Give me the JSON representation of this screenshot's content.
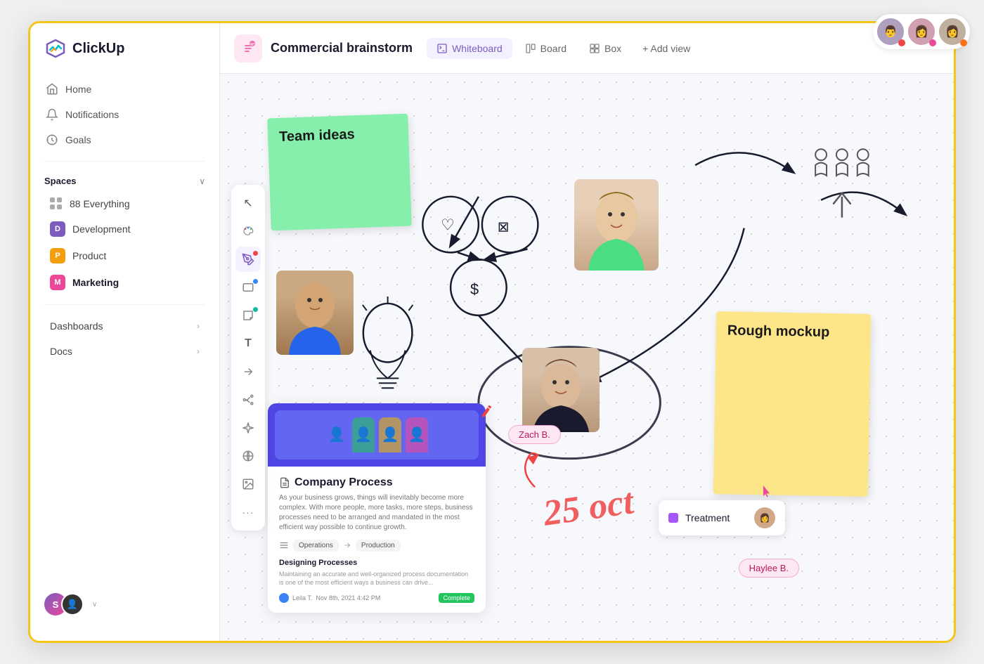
{
  "app": {
    "name": "ClickUp"
  },
  "sidebar": {
    "nav": [
      {
        "id": "home",
        "label": "Home",
        "icon": "🏠"
      },
      {
        "id": "notifications",
        "label": "Notifications",
        "icon": "🔔"
      },
      {
        "id": "goals",
        "label": "Goals",
        "icon": "🏆"
      }
    ],
    "spaces_label": "Spaces",
    "spaces": [
      {
        "id": "everything",
        "label": "Everything",
        "count": "88",
        "type": "everything"
      },
      {
        "id": "development",
        "label": "Development",
        "initial": "D",
        "color": "#7c5cbf"
      },
      {
        "id": "product",
        "label": "Product",
        "initial": "P",
        "color": "#f59e0b"
      },
      {
        "id": "marketing",
        "label": "Marketing",
        "initial": "M",
        "color": "#ec4899",
        "bold": true
      }
    ],
    "sections": [
      {
        "id": "dashboards",
        "label": "Dashboards"
      },
      {
        "id": "docs",
        "label": "Docs"
      }
    ]
  },
  "header": {
    "page_icon": "📦",
    "page_title": "Commercial brainstorm",
    "tabs": [
      {
        "id": "whiteboard",
        "label": "Whiteboard",
        "icon": "✏️",
        "active": true
      },
      {
        "id": "board",
        "label": "Board",
        "icon": "⬜"
      },
      {
        "id": "box",
        "label": "Box",
        "icon": "⊞"
      }
    ],
    "add_view_label": "+ Add view"
  },
  "whiteboard": {
    "sticky_green": "Team ideas",
    "sticky_yellow": "Rough mockup",
    "doc_title": "Company Process",
    "doc_desc": "As your business grows, things will inevitably become more complex. With more people, more tasks, more steps, business processes need to be arranged and mandated in the most efficient way possible to continue growth.",
    "doc_flow_from": "Operations",
    "doc_flow_to": "Production",
    "doc_section": "Designing Processes",
    "doc_section_text": "Maintaining an accurate and well-organized process documentation is one of the most efficient ways a business can drive...",
    "doc_author": "Leila T.",
    "doc_date": "Nov 8th, 2021 4:42 PM",
    "doc_status": "Complete",
    "treatment_label": "Treatment",
    "label_zach": "Zach B.",
    "label_haylee": "Haylee B.",
    "date_annotation": "25 oct"
  },
  "toolbar_tools": [
    {
      "id": "cursor",
      "icon": "↖",
      "dot": null
    },
    {
      "id": "palette",
      "icon": "⬡",
      "dot": null
    },
    {
      "id": "pen",
      "icon": "✏",
      "dot": "red",
      "active": true
    },
    {
      "id": "rectangle",
      "icon": "▭",
      "dot": null
    },
    {
      "id": "sticky",
      "icon": "⬛",
      "dot": "blue"
    },
    {
      "id": "text",
      "icon": "T",
      "dot": null
    },
    {
      "id": "arrow",
      "icon": "↗",
      "dot": null
    },
    {
      "id": "connect",
      "icon": "⬡",
      "dot": null
    },
    {
      "id": "sparkle",
      "icon": "✦",
      "dot": null
    },
    {
      "id": "globe",
      "icon": "🌐",
      "dot": null
    },
    {
      "id": "image",
      "icon": "🖼",
      "dot": null
    },
    {
      "id": "more",
      "icon": "•••",
      "dot": null
    }
  ]
}
